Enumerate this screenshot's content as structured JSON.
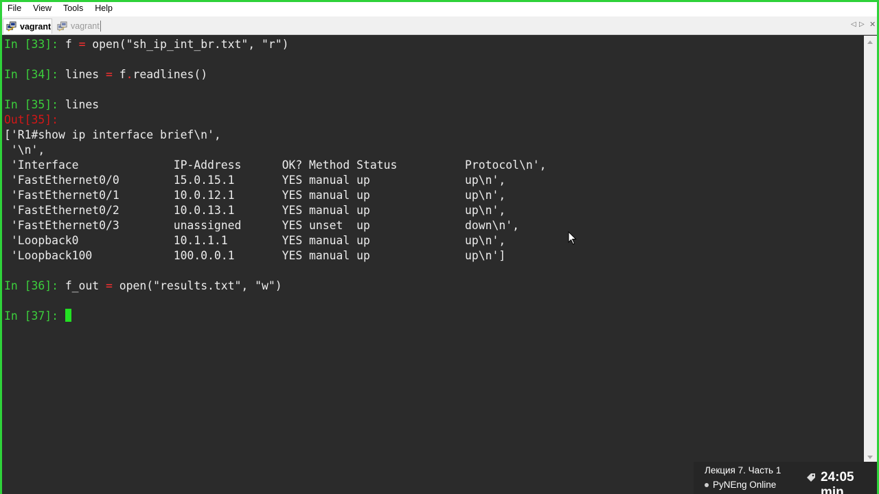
{
  "menubar": {
    "items": [
      "File",
      "View",
      "Tools",
      "Help"
    ]
  },
  "tabs": [
    {
      "label": "vagrant",
      "icon": "putty-icon",
      "active": true
    },
    {
      "label": "vagrant",
      "icon": "putty-icon",
      "active": false
    }
  ],
  "tab_nav": {
    "prev": "◁",
    "next": "▷",
    "close": "✕"
  },
  "terminal": {
    "lines": [
      {
        "prompt": "In [33]: ",
        "kind": "in",
        "code": [
          {
            "t": "f "
          },
          {
            "t": "=",
            "op": true
          },
          {
            "t": " open(\"sh_ip_int_br.txt\", \"r\")"
          }
        ]
      },
      {
        "prompt": "In [34]: ",
        "kind": "in",
        "code": [
          {
            "t": "lines "
          },
          {
            "t": "=",
            "op": true
          },
          {
            "t": " f"
          },
          {
            "t": ".",
            "op": true
          },
          {
            "t": "readlines()"
          }
        ]
      },
      {
        "prompt": "In [35]: ",
        "kind": "in",
        "code": [
          {
            "t": "lines"
          }
        ]
      },
      {
        "prompt": "Out[35]:",
        "kind": "out",
        "code": []
      },
      {
        "text": "['R1#show ip interface brief\\n',"
      },
      {
        "text": " '\\n',"
      },
      {
        "text": " 'Interface              IP-Address      OK? Method Status          Protocol\\n',"
      },
      {
        "text": " 'FastEthernet0/0        15.0.15.1       YES manual up              up\\n',"
      },
      {
        "text": " 'FastEthernet0/1        10.0.12.1       YES manual up              up\\n',"
      },
      {
        "text": " 'FastEthernet0/2        10.0.13.1       YES manual up              up\\n',"
      },
      {
        "text": " 'FastEthernet0/3        unassigned      YES unset  up              down\\n',"
      },
      {
        "text": " 'Loopback0              10.1.1.1        YES manual up              up\\n',"
      },
      {
        "text": " 'Loopback100            100.0.0.1       YES manual up              up\\n']"
      },
      {
        "prompt": "In [36]: ",
        "kind": "in",
        "code": [
          {
            "t": "f_out "
          },
          {
            "t": "=",
            "op": true
          },
          {
            "t": " open(\"results.txt\", \"w\")"
          }
        ]
      },
      {
        "prompt": "In [37]: ",
        "kind": "in",
        "code": [],
        "cursor": true
      }
    ]
  },
  "overlay": {
    "title": "Лекция 7. Часть 1",
    "subtitle": "PyNEng Online",
    "time": "24:05 min"
  },
  "colors": {
    "frame": "#2fd23a",
    "background": "#2b2b2b",
    "prompt_in": "#3ccf3c",
    "prompt_out": "#d41717",
    "operator": "#ff3030",
    "cursor": "#22e022",
    "text": "#ececec"
  }
}
